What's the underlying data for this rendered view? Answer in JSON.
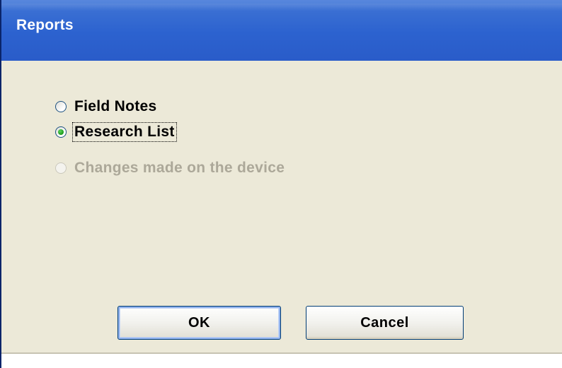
{
  "window": {
    "title": "Reports"
  },
  "options": [
    {
      "label": "Field Notes",
      "checked": false,
      "enabled": true
    },
    {
      "label": "Research List",
      "checked": true,
      "enabled": true
    },
    {
      "label": "Changes made on the device",
      "checked": false,
      "enabled": false
    }
  ],
  "buttons": {
    "ok_label": "OK",
    "cancel_label": "Cancel"
  },
  "colors": {
    "titlebar": "#2c62cf",
    "client_background": "#ece9d8",
    "radio_selected": "#21a121",
    "disabled_text": "#aca899"
  }
}
